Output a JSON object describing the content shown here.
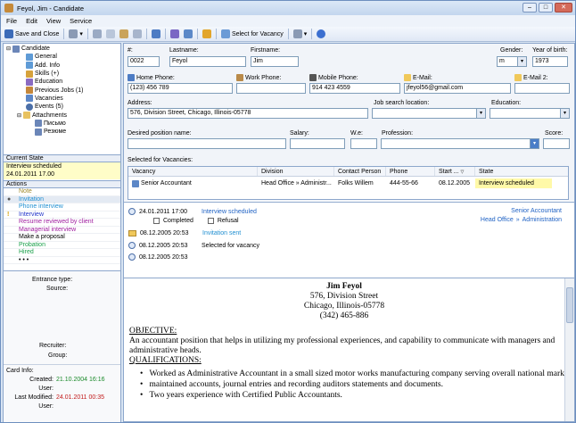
{
  "window": {
    "title": "Feyol, Jim - Candidate"
  },
  "menu": [
    "File",
    "Edit",
    "View",
    "Service"
  ],
  "toolbar": {
    "save_close": "Save and Close",
    "select_vacancy": "Select for Vacancy"
  },
  "tree": [
    {
      "label": "Candidate",
      "icon": "candidate-icon",
      "color": "#6b86b8"
    },
    {
      "label": "General",
      "icon": "general-icon",
      "color": "#5f9bd6"
    },
    {
      "label": "Add. Info",
      "icon": "info-icon",
      "color": "#5f9bd6"
    },
    {
      "label": "Skills (+)",
      "icon": "skills-icon",
      "color": "#d6a23c"
    },
    {
      "label": "Education",
      "icon": "education-icon",
      "color": "#8a6bc2"
    },
    {
      "label": "Previous Jobs (1)",
      "icon": "jobs-icon",
      "color": "#c5873a"
    },
    {
      "label": "Vacancies",
      "icon": "vacancies-icon",
      "color": "#5c87c7"
    },
    {
      "label": "Events  (5)",
      "icon": "events-icon",
      "color": "#4b6fa8"
    },
    {
      "label": "Attachments",
      "icon": "folder-icon",
      "color": "#e8c260"
    },
    {
      "label": "Письмо",
      "icon": "document-icon",
      "color": "#6b86b8"
    },
    {
      "label": "Резюме",
      "icon": "document-icon",
      "color": "#6b86b8"
    }
  ],
  "current_state": {
    "header": "Current State",
    "status": "Interview scheduled",
    "date": "24.01.2011 17.00"
  },
  "actions": {
    "header": "Actions",
    "items": [
      {
        "label": "Note",
        "color": "#a08a2a",
        "mark": ""
      },
      {
        "label": "Invitation",
        "color": "#1f8fd1",
        "mark": "●"
      },
      {
        "label": "Phone interview",
        "color": "#1f8fd1",
        "mark": ""
      },
      {
        "label": "Interview",
        "color": "#2336c9",
        "mark": "!"
      },
      {
        "label": "Resume reviewed by client",
        "color": "#a020a0",
        "mark": ""
      },
      {
        "label": "Managerial interview",
        "color": "#a020a0",
        "mark": ""
      },
      {
        "label": "Make a proposal",
        "color": "#000000",
        "mark": ""
      },
      {
        "label": "Probation",
        "color": "#1aa04a",
        "mark": ""
      },
      {
        "label": "Hired",
        "color": "#1aa04a",
        "mark": ""
      },
      {
        "label": "• • •",
        "color": "#000000",
        "mark": ""
      }
    ]
  },
  "info": {
    "entrance_type": "Entrance type:",
    "source": "Source:",
    "recruiter": "Recruiter:",
    "group": "Group:"
  },
  "card_info": {
    "title": "Card Info:",
    "created_label": "Created:",
    "created": "21.10.2004 16:16",
    "user_label": "User:",
    "modified_label": "Last Modified:",
    "modified": "24.01.2011 00:35",
    "user2_label": "User:"
  },
  "form": {
    "num_label": "#:",
    "num": "0022",
    "lastname_label": "Lastname:",
    "lastname": "Feyol",
    "firstname_label": "Firstname:",
    "firstname": "Jim",
    "gender_label": "Gender:",
    "gender": "m",
    "yob_label": "Year of birth:",
    "yob": "1973",
    "home_label": "Home Phone:",
    "home": "(123) 456 789",
    "work_label": "Work Phone:",
    "work": "",
    "mobile_label": "Mobile Phone:",
    "mobile": "914 423 4559",
    "email_label": "E-Mail:",
    "email": "jfeyol56@gmail.com",
    "email2_label": "E-Mail 2:",
    "email2": "",
    "address_label": "Address:",
    "address": "576, Division Street, Chicago, Illinois-05778",
    "jsl_label": "Job search location:",
    "edu_label": "Education:",
    "dpn_label": "Desired position name:",
    "salary_label": "Salary:",
    "we_label": "W.e:",
    "profession_label": "Profession:",
    "score_label": "Score:",
    "sfv_label": "Selected for Vacancies:"
  },
  "vacancies": {
    "columns": [
      "Vacancy",
      "Division",
      "Contact Person",
      "Phone",
      "Start ...",
      "State"
    ],
    "rows": [
      [
        "Senior Accountant",
        "Head Office  »  Administr...",
        "Folks Willem",
        "444-55-66",
        "08.12.2005",
        "Interview scheduled"
      ]
    ]
  },
  "history": {
    "right1": "Senior Accountant",
    "right2a": "Head Office",
    "right2b": "»",
    "right2c": "Administration",
    "items": [
      {
        "date": "24.01.2011  17:00",
        "text": "Interview scheduled",
        "color": "#1f62c4"
      },
      {
        "date": "08.12.2005  20:53",
        "text": "Invitation sent",
        "color": "#1f8fd1"
      },
      {
        "date": "08.12.2005  20:53",
        "text": "Selected for vacancy",
        "color": "#000000"
      },
      {
        "date": "08.12.2005  20:53",
        "text": "",
        "color": "#000000"
      }
    ],
    "completed": "Completed",
    "refusal": "Refusal"
  },
  "resume": {
    "name": "Jim Feyol",
    "addr1": "576, Division Street",
    "addr2": "Chicago, Illinois-05778",
    "phone": "(342) 465-886",
    "objective_h": "OBJECTIVE:",
    "objective_1": "An accountant position that helps in utilizing my professional experiences, and capability to communicate with managers and",
    "objective_2": "administrative heads.",
    "qual_h": "QUALIFICATIONS:",
    "bullets": [
      "Worked as Administrative Accountant in a small sized motor works manufacturing company serving overall national market.",
      "maintained accounts, journal entries and recording auditors statements and documents.",
      "Two years experience with Certified Public Accountants."
    ]
  }
}
